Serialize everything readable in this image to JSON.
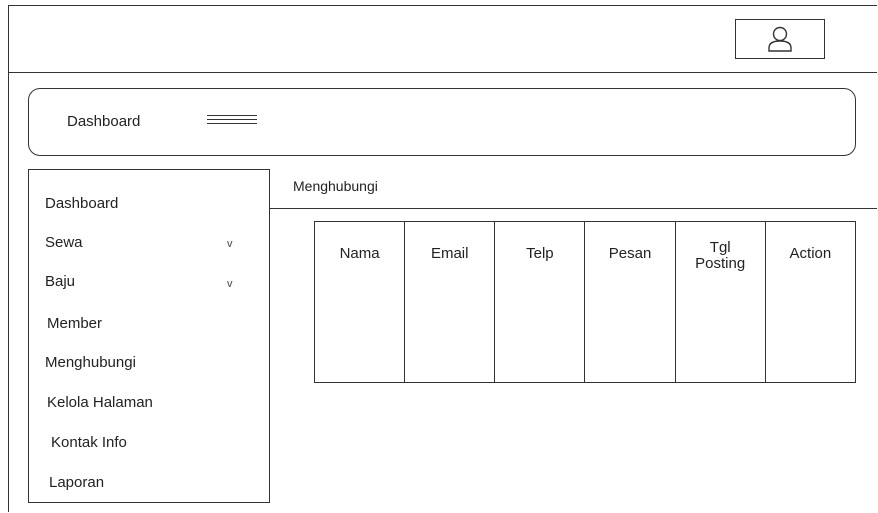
{
  "header": {
    "title": "Dashboard"
  },
  "sidebar": {
    "items": [
      {
        "label": "Dashboard"
      },
      {
        "label": "Sewa",
        "chevron": "v"
      },
      {
        "label": "Baju",
        "chevron": "v"
      },
      {
        "label": "Member"
      },
      {
        "label": "Menghubungi"
      },
      {
        "label": "Kelola Halaman"
      },
      {
        "label": "Kontak Info"
      },
      {
        "label": "Laporan"
      }
    ]
  },
  "main": {
    "section_title": "Menghubungi",
    "table": {
      "columns": [
        "Nama",
        "Email",
        "Telp",
        "Pesan",
        "Tgl\nPosting",
        "Action"
      ]
    }
  },
  "icons": {
    "user": "user-icon",
    "menu": "hamburger-menu-icon"
  }
}
